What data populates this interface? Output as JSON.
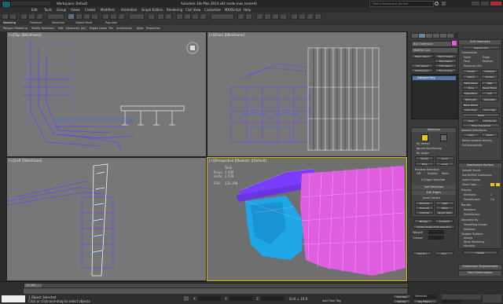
{
  "window": {
    "title": "Autodesk 3ds Max 2014 x64     mode.max (solved)",
    "workspace": "Workspace: Default",
    "search_placeholder": "Type a keyword or phrase"
  },
  "menu": [
    "Edit",
    "Tools",
    "Group",
    "Views",
    "Create",
    "Modifiers",
    "Animation",
    "Graph Editors",
    "Rendering",
    "Civil View",
    "Customize",
    "MAXScript",
    "Help"
  ],
  "ribbon": {
    "tabs": [
      "Modeling",
      "Freeform",
      "Selection",
      "Object Paint",
      "Populate"
    ],
    "items": [
      "Polygon Modeling",
      "Modify Selection",
      "Edit",
      "Geometry (All)",
      "Edges",
      "Loops",
      "Tris",
      "Subdivision",
      "Align",
      "Properties"
    ]
  },
  "viewports": {
    "top": "[+][Top ][Wireframe]",
    "front": "[+][Front ][Wireframe]",
    "left": "[+][Left ][Wireframe]",
    "perspective": "[+][Perspective ][Realistic ][Default]"
  },
  "stats": {
    "total_label": "Total",
    "polys_label": "Polys:",
    "polys_value": "1 456",
    "verts_label": "Verts:",
    "verts_value": "1 578",
    "fps_label": "FPS:",
    "fps_value": "135.398"
  },
  "command_panel": {
    "object_name": "Box Extension",
    "modifier_list": "Modifier List",
    "buttons": [
      "Mesh Select",
      "Patch Select",
      "Poly Select",
      "Vol. Select",
      "FFD Select",
      "Turn to Poly",
      "Extrude",
      "Shell"
    ],
    "subdivision_label": "Subdivision",
    "stack_item": "Editable Poly",
    "selection_title": "Selection",
    "selection_items": [
      "By Vertex",
      "Ignore Backfacing",
      "By Angle",
      "Shrink",
      "Grow",
      "Ring",
      "Loop"
    ],
    "preview_selection": "Preview Selection",
    "preview_options": [
      "Off",
      "SubObj",
      "Multi"
    ],
    "selected_info": "0 Edges Selected",
    "soft_selection": "Soft Selection",
    "edit_edges": "Edit Edges",
    "edit_edges_items": [
      "Insert Vertex",
      "Remove",
      "Split",
      "Extrude",
      "Weld",
      "Chamfer",
      "Target Weld",
      "Bridge",
      "Connect"
    ],
    "create_shape": "Create Shape From Selection",
    "weight": "Weight:",
    "crease": "Crease:",
    "edit_tri": "Edit Tri.",
    "turn": "Turn",
    "edit_geometry": "Edit Geometry",
    "repeat_last": "Repeat Last",
    "constraints": "Constraints",
    "constraint_options": [
      "None",
      "Edge",
      "Face",
      "Normal"
    ],
    "preserve_uvs": "Preserve UVs",
    "create": "Create",
    "collapse": "Collapse",
    "attach": "Attach",
    "detach": "Detach",
    "slice_plane": "Slice Plane",
    "split": "Split",
    "slice": "Slice",
    "reset_plane": "Reset Plane",
    "quickslice": "QuickSlice",
    "cut": "Cut",
    "msmooth": "MSmooth",
    "tessellate": "Tessellate",
    "make_planar": "Make Planar",
    "view_align": "View Align",
    "grid_align": "Grid Align",
    "relax": "Relax",
    "hide_selected": "Hide Selected",
    "unhide_all": "Unhide All",
    "hide_unselected": "Hide Unselected",
    "named_selections": "Named Selections:",
    "copy": "Copy",
    "paste": "Paste",
    "delete_isolated": "Delete Isolated Vertices",
    "full_interactivity": "Full Interactivity",
    "subdivision_surface": "Subdivision Surface",
    "smooth_result": "Smooth Result",
    "use_nurms": "Use NURMS Subdivision",
    "isoline_display": "Isoline Display",
    "show_cage": "Show Cage......",
    "display": "Display",
    "iterations": "Iterations:",
    "smoothness": "Smoothness:",
    "render": "Render",
    "separate_by": "Separate By",
    "smoothing_groups": "Smoothing Groups",
    "materials": "Materials",
    "update_options": "Update Options",
    "always": "Always",
    "when_rendering": "When Rendering",
    "manually": "Manually",
    "update": "Update",
    "subdivision_displacement": "Subdivision Displacement",
    "paint_deformation": "Paint Deformation",
    "values": {
      "iterations": "1",
      "smoothness": "1.0"
    }
  },
  "status": {
    "frame": "0 / 100",
    "selected": "1 Object Selected",
    "prompt": "Click or click-and-drag to select objects",
    "x_label": "X:",
    "y_label": "Y:",
    "z_label": "Z:",
    "grid": "Grid = 10.0",
    "auto_key": "Auto Key",
    "set_key": "Set Key",
    "selected_dropdown": "Selected",
    "key_filters": "Key Filters...",
    "add_time_tag": "Add Time Tag"
  },
  "colors": {
    "viewport_bg": "#777777",
    "perspective_bg": "#6f6f6f",
    "purple": "#7a3cff",
    "blue": "#1fa6e6",
    "pink": "#e05ee0"
  },
  "icons": [
    "app-logo-icon",
    "search-icon",
    "help-icon",
    "close-icon",
    "minimize-icon",
    "maximize-icon"
  ]
}
